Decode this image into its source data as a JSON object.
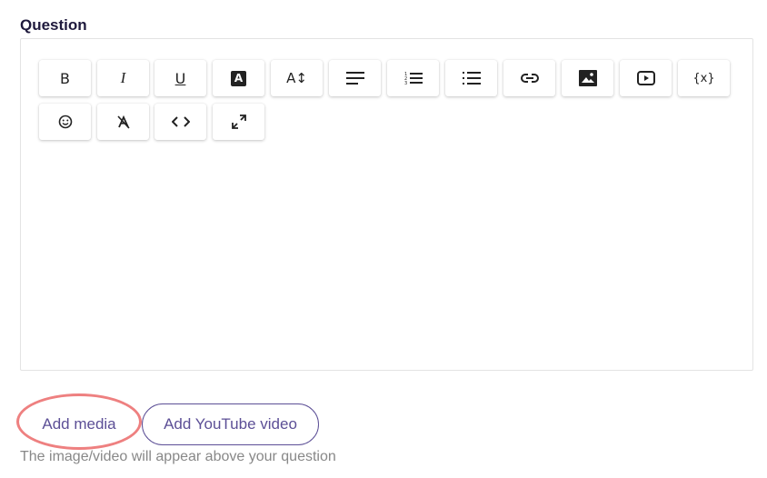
{
  "question": {
    "label": "Question"
  },
  "toolbar": {
    "buttons": [
      {
        "name": "bold-button",
        "icon": "bold-icon",
        "text": "B"
      },
      {
        "name": "italic-button",
        "icon": "italic-icon",
        "text": "I"
      },
      {
        "name": "underline-button",
        "icon": "underline-icon",
        "text": "U"
      },
      {
        "name": "text-color-button",
        "icon": "text-color-icon",
        "text": "A"
      },
      {
        "name": "font-size-button",
        "icon": "font-size-icon",
        "text": "A↕"
      },
      {
        "name": "align-button",
        "icon": "align-left-icon"
      },
      {
        "name": "ordered-list-button",
        "icon": "ordered-list-icon"
      },
      {
        "name": "bullet-list-button",
        "icon": "bullet-list-icon"
      },
      {
        "name": "link-button",
        "icon": "link-icon"
      },
      {
        "name": "image-button",
        "icon": "image-icon"
      },
      {
        "name": "video-button",
        "icon": "video-icon"
      },
      {
        "name": "variable-button",
        "icon": "variable-icon",
        "text": "{x}"
      },
      {
        "name": "emoji-button",
        "icon": "emoji-icon"
      },
      {
        "name": "clear-format-button",
        "icon": "clear-format-icon"
      },
      {
        "name": "code-button",
        "icon": "code-icon"
      },
      {
        "name": "fullscreen-button",
        "icon": "expand-icon"
      }
    ]
  },
  "media": {
    "add_media_label": "Add media",
    "add_youtube_label": "Add YouTube video",
    "hint": "The image/video will appear above your question"
  },
  "colors": {
    "accent": "#5c4f96",
    "highlight": "#ee8080",
    "title": "#1f1a3d",
    "hint": "#888888"
  }
}
